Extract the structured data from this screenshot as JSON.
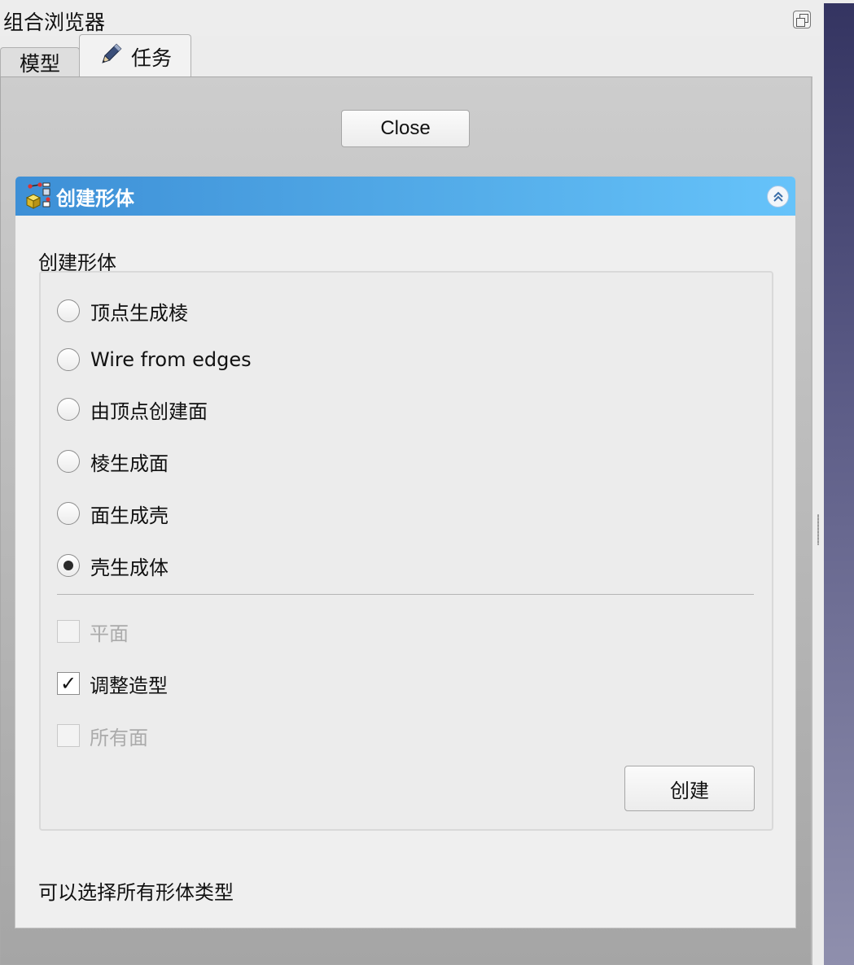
{
  "panel": {
    "title": "组合浏览器"
  },
  "tabs": [
    {
      "label": "模型"
    },
    {
      "label": "任务"
    }
  ],
  "close_label": "Close",
  "task": {
    "header_title": "创建形体",
    "group_label": "创建形体",
    "radios": [
      {
        "label": "顶点生成棱",
        "checked": false
      },
      {
        "label": "Wire from edges",
        "checked": false
      },
      {
        "label": "由顶点创建面",
        "checked": false
      },
      {
        "label": "棱生成面",
        "checked": false
      },
      {
        "label": "面生成壳",
        "checked": false
      },
      {
        "label": "壳生成体",
        "checked": true
      }
    ],
    "checkboxes": [
      {
        "label": "平面",
        "checked": false,
        "enabled": false
      },
      {
        "label": "调整造型",
        "checked": true,
        "enabled": true
      },
      {
        "label": "所有面",
        "checked": false,
        "enabled": false
      }
    ],
    "check_mark": "✓",
    "create_label": "创建",
    "hint": "可以选择所有形体类型"
  },
  "colors": {
    "header_start": "#3d8fd6",
    "header_end": "#66c3fa",
    "view_top": "#343461",
    "view_bottom": "#8f8fad"
  }
}
